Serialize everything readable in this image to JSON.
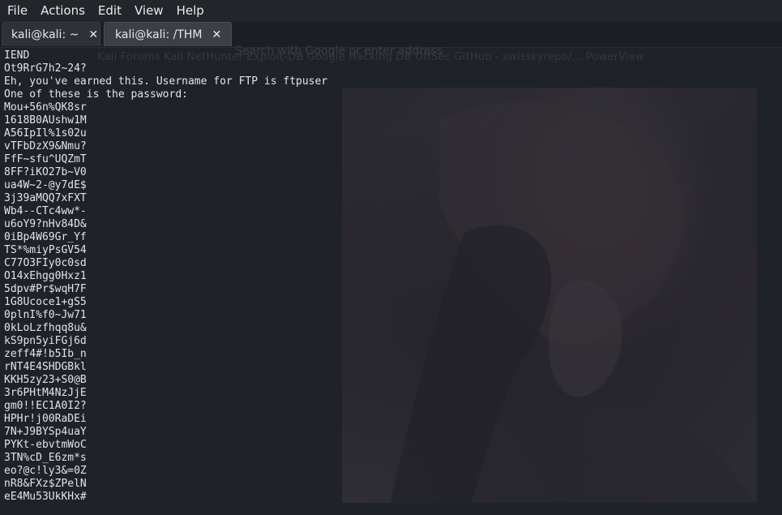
{
  "menubar": {
    "items": [
      "File",
      "Actions",
      "Edit",
      "View",
      "Help"
    ]
  },
  "tabs": [
    {
      "label": "kali@kali: ~",
      "close": "✕"
    },
    {
      "label": "kali@kali: /THM",
      "close": "✕"
    }
  ],
  "background_text": {
    "url_hint": "Search with Google or enter address",
    "bookmarks": "Kali Forums   Kali NetHunter   Exploit-DB   Google Hacking DB   OffSec   GitHub - swisskyrepo/...   PowerView"
  },
  "terminal": {
    "lines": [
      "IEND",
      "Ot9RrG7h2~24?",
      "Eh, you've earned this. Username for FTP is ftpuser",
      "One of these is the password:",
      "Mou+56n%QK8sr",
      "1618B0AUshw1M",
      "A56IpIl%1s02u",
      "vTFbDzX9&Nmu?",
      "FfF~sfu^UQZmT",
      "8FF?iKO27b~V0",
      "ua4W~2-@y7dE$",
      "3j39aMQQ7xFXT",
      "Wb4--CTc4ww*-",
      "u6oY9?nHv84D&",
      "0iBp4W69Gr_Yf",
      "TS*%miyPsGV54",
      "C77O3FIy0c0sd",
      "O14xEhgg0Hxz1",
      "5dpv#Pr$wqH7F",
      "1G8Ucoce1+gS5",
      "0plnI%f0~Jw71",
      "0kLoLzfhqq8u&",
      "kS9pn5yiFGj6d",
      "zeff4#!b5Ib_n",
      "rNT4E4SHDGBkl",
      "KKH5zy23+S0@B",
      "3r6PHtM4NzJjE",
      "gm0!!EC1A0I2?",
      "HPHr!j00RaDEi",
      "7N+J9BYSp4uaY",
      "PYKt-ebvtmWoC",
      "3TN%cD_E6zm*s",
      "eo?@c!ly3&=0Z",
      "nR8&FXz$ZPelN",
      "eE4Mu53UkKHx#"
    ]
  }
}
